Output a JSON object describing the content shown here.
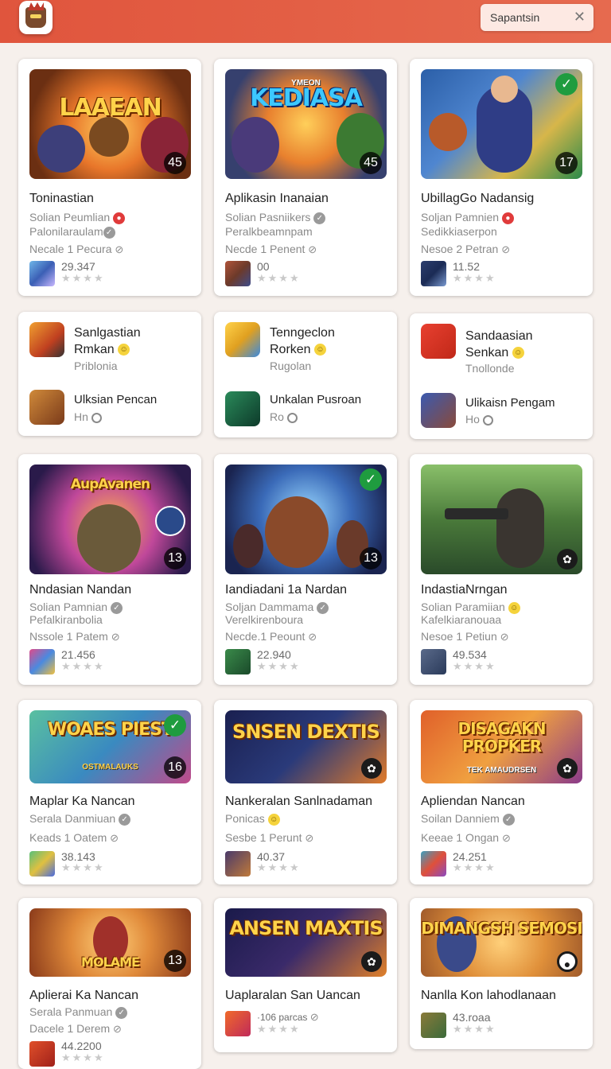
{
  "header": {
    "search_placeholder": "Sapantsin",
    "clear_icon": "close-icon"
  },
  "row1": [
    {
      "thumb_text": "LAAEAN",
      "thumb_sub": "",
      "badge": "45",
      "title": "Toninastian",
      "line1": "Solian Peumlian",
      "line2": "Palonilaraulam",
      "line3": "Necale 1 Pecura",
      "stat": "29.347",
      "stars": "★★★★"
    },
    {
      "thumb_text": "KEDIASA",
      "thumb_sub": "YMEON",
      "badge": "45",
      "title": "Aplikasin Inanaian",
      "line1": "Solian Pasniikers",
      "line2": "Peralkbeamnpam",
      "line3": "Necde 1 Penent",
      "stat": "00",
      "stars": "★★★★"
    },
    {
      "thumb_text": "",
      "thumb_sub": "",
      "badge": "17",
      "title": "UbillagGo Nadansig",
      "line1": "Soljan Pamnien",
      "line2": "Sedikkiaserpon",
      "line3": "Nesoe 2 Petran",
      "stat": "11.52",
      "stars": "★★★★"
    }
  ],
  "row2": [
    {
      "title_a": "Sanlgastian",
      "title_b": "Rmkan",
      "sub": "Priblonia",
      "item_title": "Ulksian Pencan",
      "item_sub": "Hn"
    },
    {
      "title_a": "Tenngeclon",
      "title_b": "Rorken",
      "sub": "Rugolan",
      "item_title": "Unkalan Pusroan",
      "item_sub": "Ro"
    },
    {
      "title_a": "Sandaasian",
      "title_b": "Senkan",
      "sub": "Tnollonde",
      "item_title": "Ulikaisn Pengam",
      "item_sub": "Ho"
    }
  ],
  "row3": [
    {
      "thumb_text": "AupAvanen",
      "thumb_sub": "",
      "badge": "13",
      "title": "Nndasian Nandan",
      "line1": "Solian Pamnian",
      "line2": "Pefalkiranbolia",
      "line3": "Nssole 1 Patem",
      "stat": "21.456",
      "stars": "★★★★"
    },
    {
      "thumb_text": "",
      "thumb_sub": "",
      "badge": "13",
      "title": "Iandiadani 1a Nardan",
      "line1": "Soljan Dammama",
      "line2": "Verelkirenboura",
      "line3": "Necde.1 Peount",
      "stat": "22.940",
      "stars": "★★★★"
    },
    {
      "thumb_text": "",
      "thumb_sub": "",
      "badge": "",
      "title": "IndastiaNrngan",
      "line1": "Solian Paramiian",
      "line2": "Kafelkiaranouaa",
      "line3": "Nesoe 1 Petiun",
      "stat": "49.534",
      "stars": "★★★★"
    }
  ],
  "row4": [
    {
      "thumb_text": "WOAES PIEST",
      "thumb_sub": "OSTMALAUKS",
      "badge": "16",
      "title": "Maplar Ka Nancan",
      "line1": "Serala Danmiuan",
      "line2": "",
      "line3": "Keads 1 Oatem",
      "stat": "38.143",
      "stars": "★★★★"
    },
    {
      "thumb_text": "SNSEN DEXTIS",
      "thumb_sub": "",
      "badge": "",
      "title": "Nankeralan Sanlnadaman",
      "line1": "Ponicas",
      "line2": "",
      "line3": "Sesbe 1 Perunt",
      "stat": "40.37",
      "stars": "★★★★"
    },
    {
      "thumb_text": "DISAGAKN PROPKER",
      "thumb_sub": "TEK AMAUDRSEN",
      "badge": "",
      "title": "Apliendan Nancan",
      "line1": "Soilan Danniem",
      "line2": "",
      "line3": "Keeae 1 Ongan",
      "stat": "24.251",
      "stars": "★★★★"
    }
  ],
  "row5": [
    {
      "thumb_text": "MOLAME",
      "thumb_sub": "",
      "badge": "13",
      "title": "Aplierai Ka Nancan",
      "line1": "Serala Panmuan",
      "line3": "Dacele 1 Derem",
      "stat": "44.2200",
      "stars": "★★★★"
    },
    {
      "thumb_text": "ANSEN MAXTIS",
      "thumb_sub": "",
      "badge": "",
      "title": "Uaplaralan San Uancan",
      "line1": "",
      "line3": "parcas",
      "stat": "·106",
      "stars": "★★★★"
    },
    {
      "thumb_text": "DIMANGSH SEMOSI",
      "thumb_sub": "",
      "badge": "",
      "title": "Nanlla Kon lahodlanaan",
      "line1": "",
      "line3": "",
      "stat": "43.roaa",
      "stars": "★★★★"
    }
  ],
  "colors": {
    "header": "#e35f45",
    "accent_check": "#1f9c3f",
    "badge_red": "#e03b3b"
  }
}
